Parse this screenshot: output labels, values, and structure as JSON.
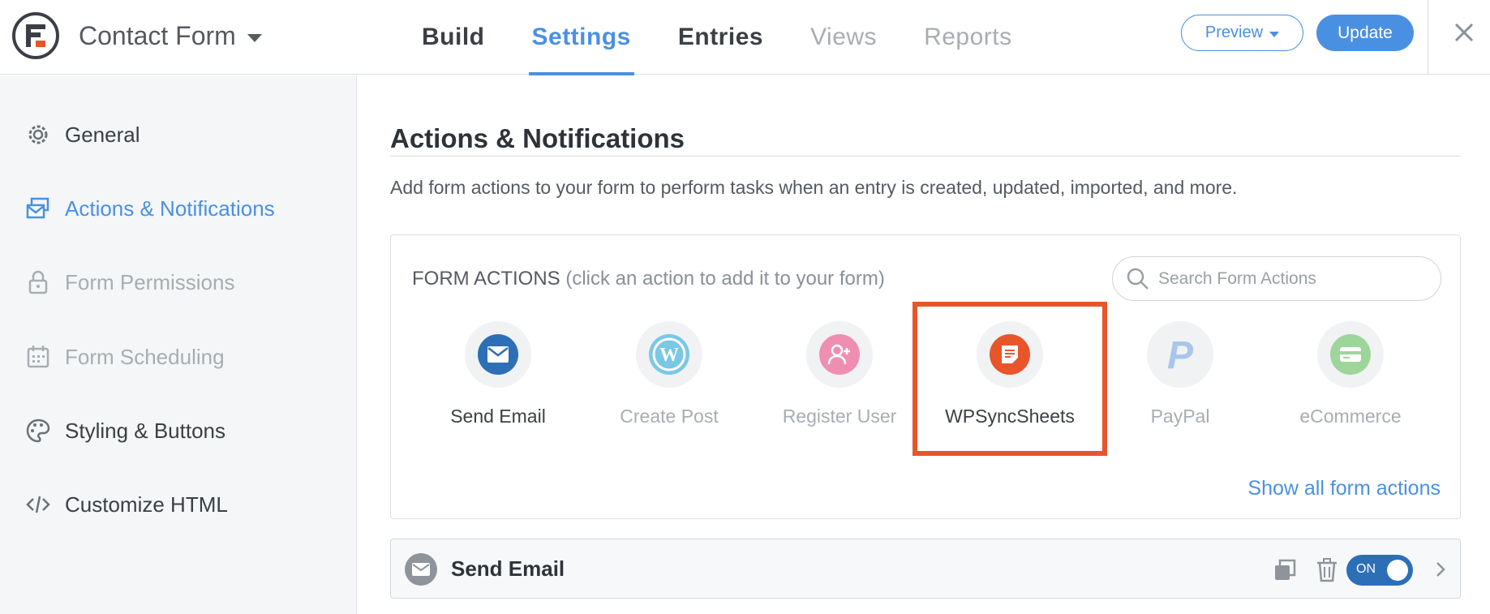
{
  "header": {
    "form_title": "Contact Form",
    "tabs": [
      {
        "label": "Build"
      },
      {
        "label": "Settings"
      },
      {
        "label": "Entries"
      },
      {
        "label": "Views"
      },
      {
        "label": "Reports"
      }
    ],
    "active_tab": "Settings",
    "preview_label": "Preview",
    "update_label": "Update"
  },
  "sidebar": {
    "items": [
      {
        "label": "General",
        "icon": "gear-icon",
        "state": "normal"
      },
      {
        "label": "Actions & Notifications",
        "icon": "envelopes-icon",
        "state": "active"
      },
      {
        "label": "Form Permissions",
        "icon": "lock-icon",
        "state": "disabled"
      },
      {
        "label": "Form Scheduling",
        "icon": "calendar-icon",
        "state": "disabled"
      },
      {
        "label": "Styling & Buttons",
        "icon": "palette-icon",
        "state": "normal"
      },
      {
        "label": "Customize HTML",
        "icon": "code-icon",
        "state": "normal"
      }
    ]
  },
  "main": {
    "title": "Actions & Notifications",
    "description": "Add form actions to your form to perform tasks when an entry is created, updated, imported, and more.",
    "form_actions": {
      "heading": "FORM ACTIONS",
      "hint": "(click an action to add it to your form)",
      "search_placeholder": "Search Form Actions",
      "items": [
        {
          "label": "Send Email",
          "icon": "envelope-icon",
          "color": "#2c6fb7",
          "enabled": true
        },
        {
          "label": "Create Post",
          "icon": "wordpress-icon",
          "color": "#7ac7e6",
          "enabled": false
        },
        {
          "label": "Register User",
          "icon": "add-user-icon",
          "color": "#ee8fb2",
          "enabled": false
        },
        {
          "label": "WPSyncSheets",
          "icon": "sheet-icon",
          "color": "#e8552a",
          "enabled": true,
          "highlighted": true
        },
        {
          "label": "PayPal",
          "icon": "paypal-icon",
          "color": "#a9c6ea",
          "enabled": false
        },
        {
          "label": "eCommerce",
          "icon": "credit-card-icon",
          "color": "#9ed59a",
          "enabled": false
        }
      ],
      "show_all_label": "Show all form actions"
    },
    "installed_action": {
      "name": "Send Email",
      "toggle_label": "ON"
    }
  },
  "colors": {
    "accent": "#4a90e2",
    "highlight": "#e8552a",
    "toggle_on": "#2c6fb7"
  }
}
